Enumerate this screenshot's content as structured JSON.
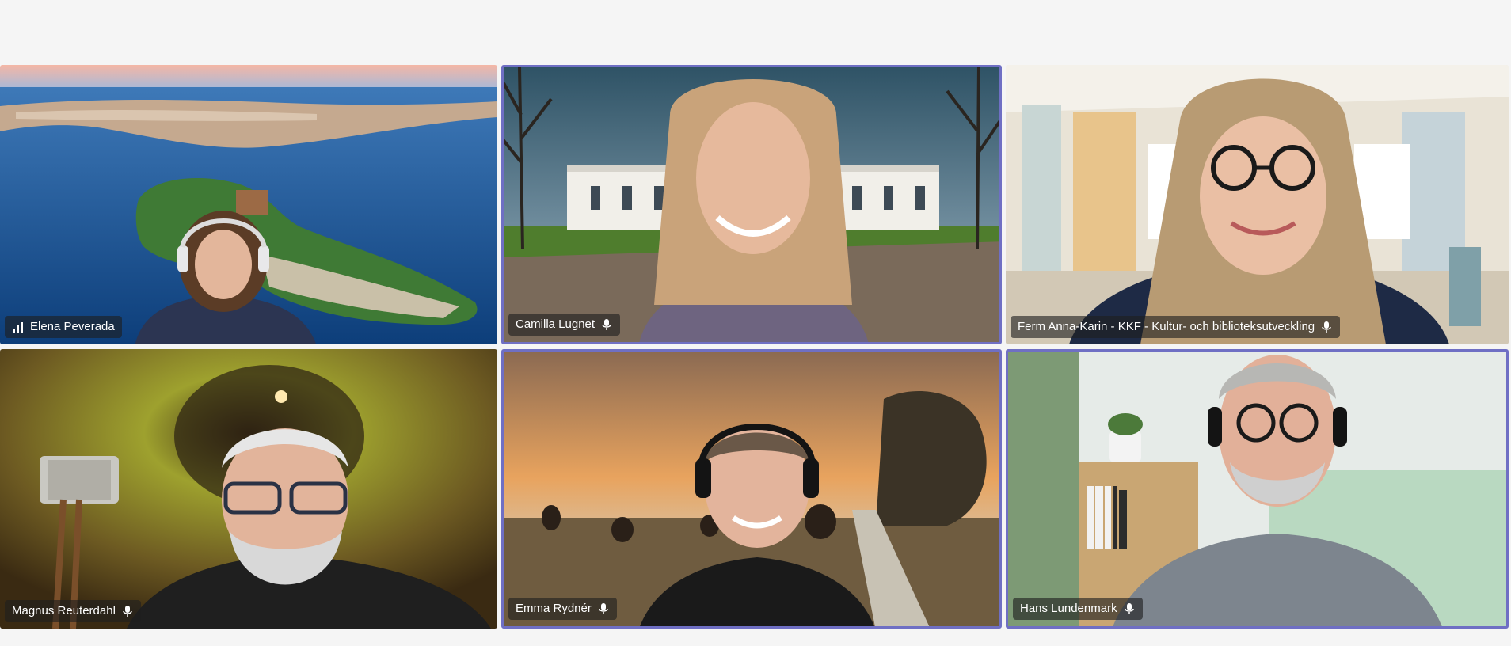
{
  "meeting": {
    "participants": [
      {
        "name": "Elena Peverada",
        "indicator": "signal-icon"
      },
      {
        "name": "Camilla Lugnet",
        "indicator": "mic-icon"
      },
      {
        "name": "Ferm Anna-Karin - KKF - Kultur- och biblioteksutveckling",
        "indicator": "mic-icon"
      },
      {
        "name": "Magnus Reuterdahl",
        "indicator": "mic-icon"
      },
      {
        "name": "Emma Rydnér",
        "indicator": "mic-icon"
      },
      {
        "name": "Hans Lundenmark",
        "indicator": "mic-icon"
      }
    ]
  },
  "colors": {
    "active_speaker_border": "#6f6fc4",
    "page_background": "#f5f5f5",
    "name_tag_background": "#1e1e1e"
  }
}
